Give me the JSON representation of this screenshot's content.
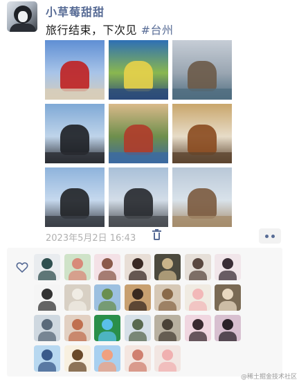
{
  "post": {
    "username": "小草莓甜甜",
    "text": "旅行结束，下次见",
    "hashtag": "#台州",
    "timestamp": "2023年5月2日 16:43"
  },
  "photos": [
    {
      "name": "photo-cruise-ship",
      "top": "#5f8fd4",
      "mid": "#a8c4e8",
      "accent": "#c02020",
      "ground": "#d8cdb8"
    },
    {
      "name": "photo-collage-map",
      "top": "#2d6fb5",
      "mid": "#8ab74f",
      "accent": "#e8d24a",
      "ground": "#2a4a7a"
    },
    {
      "name": "photo-sea-cliff",
      "top": "#c6cdd6",
      "mid": "#9aa6b2",
      "accent": "#6b5a48",
      "ground": "#4f6d80"
    },
    {
      "name": "photo-selfie-sunglasses",
      "top": "#7fa9d6",
      "mid": "#bfd4ea",
      "accent": "#1d1f24",
      "ground": "#2b2d33"
    },
    {
      "name": "photo-food-collage",
      "top": "#d9b98a",
      "mid": "#6e8f4c",
      "accent": "#b03b2a",
      "ground": "#3c6aa0"
    },
    {
      "name": "photo-dinner-dishes",
      "top": "#c9a66b",
      "mid": "#e7dcc8",
      "accent": "#8a4a1f",
      "ground": "#5d4530"
    },
    {
      "name": "photo-selfie-sky",
      "top": "#8eb3dc",
      "mid": "#c6d9ee",
      "accent": "#202226",
      "ground": "#3a3e46"
    },
    {
      "name": "photo-selfie-tripod",
      "top": "#a9c0d8",
      "mid": "#d3dde8",
      "accent": "#26282c",
      "ground": "#4a4d52"
    },
    {
      "name": "photo-rock-coast",
      "top": "#b9c8d8",
      "mid": "#d9e2ea",
      "accent": "#7b5a3e",
      "ground": "#a58c6c"
    }
  ],
  "likes": [
    {
      "name": "like-avatar-cat-doodle",
      "bg": "#e9ecef",
      "fg": "#2f4f4f"
    },
    {
      "name": "like-avatar-anime-girl",
      "bg": "#cfe3c8",
      "fg": "#d88a7a"
    },
    {
      "name": "like-avatar-illustrated-girl",
      "bg": "#f4e1e6",
      "fg": "#8b5a4b"
    },
    {
      "name": "like-avatar-girl-mirror",
      "bg": "#e8ded6",
      "fg": "#3a2a24"
    },
    {
      "name": "like-avatar-dark-scene",
      "bg": "#4c4a3e",
      "fg": "#c9b48a"
    },
    {
      "name": "like-avatar-portrait",
      "bg": "#e6dfd8",
      "fg": "#5a4840"
    },
    {
      "name": "like-avatar-anime-dark-hair",
      "bg": "#f1e6ea",
      "fg": "#3a2e36"
    },
    {
      "name": "like-avatar-sketch-girl",
      "bg": "#f5f5f5",
      "fg": "#333333"
    },
    {
      "name": "like-avatar-fluffy-cat",
      "bg": "#d8d0c4",
      "fg": "#f0ece4"
    },
    {
      "name": "like-avatar-landscape",
      "bg": "#9cc0e0",
      "fg": "#6a8f50"
    },
    {
      "name": "like-avatar-man-dark",
      "bg": "#c8a070",
      "fg": "#3a2a20"
    },
    {
      "name": "like-avatar-hands-cards",
      "bg": "#d6c8b6",
      "fg": "#8a6a4a"
    },
    {
      "name": "like-avatar-cartoon-pig",
      "bg": "#f0ebe2",
      "fg": "#f2b8b8"
    },
    {
      "name": "like-avatar-cute-animal",
      "bg": "#7a6a54",
      "fg": "#e8d8c0"
    },
    {
      "name": "like-avatar-girl-cap",
      "bg": "#cfd8e0",
      "fg": "#5a6a7a"
    },
    {
      "name": "like-avatar-child",
      "bg": "#e2d0c2",
      "fg": "#c07050"
    },
    {
      "name": "like-avatar-green-dot",
      "bg": "#2a8f4a",
      "fg": "#5ac0e8"
    },
    {
      "name": "like-avatar-tree-scene",
      "bg": "#d6e0e8",
      "fg": "#5a6a50"
    },
    {
      "name": "like-avatar-dog-photo",
      "bg": "#b8b0a0",
      "fg": "#4a4238"
    },
    {
      "name": "like-avatar-pink-girl",
      "bg": "#f0d6e0",
      "fg": "#3a2a30"
    },
    {
      "name": "like-avatar-sunglasses-girl",
      "bg": "#d8c0d0",
      "fg": "#2a2228"
    },
    {
      "name": "like-avatar-blue-figure",
      "bg": "#b8d8f0",
      "fg": "#3a5a8a"
    },
    {
      "name": "like-avatar-cartoon-boy",
      "bg": "#f8f0e0",
      "fg": "#6a4a2a"
    },
    {
      "name": "like-avatar-cartoon-couple",
      "bg": "#a8d0f0",
      "fg": "#f0a080"
    },
    {
      "name": "like-avatar-peach-girl",
      "bg": "#f4e6e0",
      "fg": "#d08070"
    },
    {
      "name": "like-avatar-pig-plush",
      "bg": "#f2e6e2",
      "fg": "#f0b0b0"
    }
  ],
  "watermark": "@稀土掘金技术社区"
}
